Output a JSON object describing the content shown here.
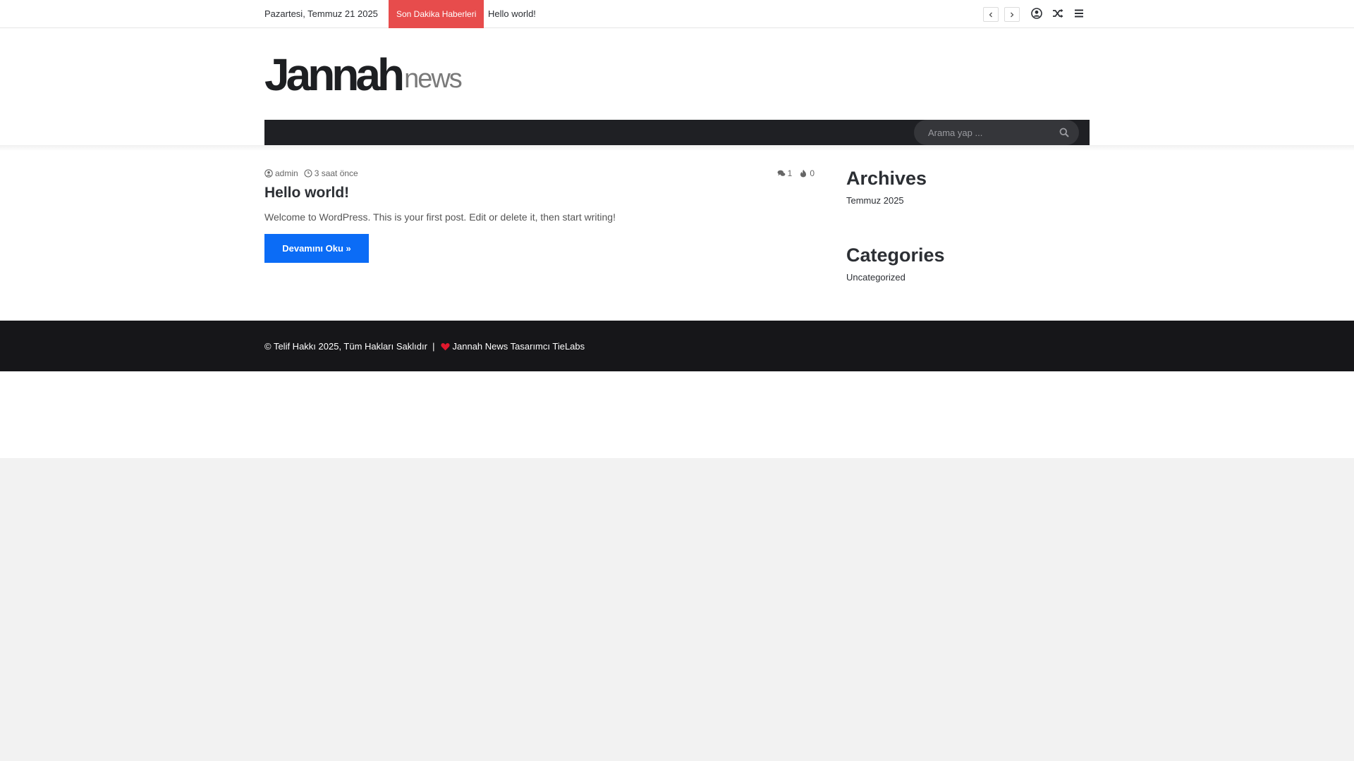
{
  "topbar": {
    "date": "Pazartesi, Temmuz 21 2025",
    "breaking_label": "Son Dakika Haberleri",
    "breaking_item": "Hello world!",
    "icons": [
      "chevron-left-icon",
      "chevron-right-icon",
      "user-icon",
      "random-icon",
      "menu-icon"
    ]
  },
  "header": {
    "logo_main": "Jannah",
    "logo_sub": "news",
    "search_placeholder": "Arama yap ..."
  },
  "post": {
    "author": "admin",
    "time": "3 saat önce",
    "comments": "1",
    "views": "0",
    "title": "Hello world!",
    "excerpt": "Welcome to WordPress. This is your first post. Edit or delete it, then start writing!",
    "more_label": "Devamını Oku »"
  },
  "sidebar": {
    "archives_title": "Archives",
    "archives_items": [
      "Temmuz 2025"
    ],
    "categories_title": "Categories",
    "categories_items": [
      "Uncategorized"
    ]
  },
  "footer": {
    "copyright": "© Telif Hakkı 2025, Tüm Hakları Saklıdır  |",
    "credit": "Jannah News Tasarımcı TieLabs"
  },
  "colors": {
    "breaking": "#e74c4c",
    "accent_button": "#0b6cf6",
    "nav_bg": "#1f2024",
    "footer_bg": "#161619",
    "heart": "#e0182d"
  }
}
